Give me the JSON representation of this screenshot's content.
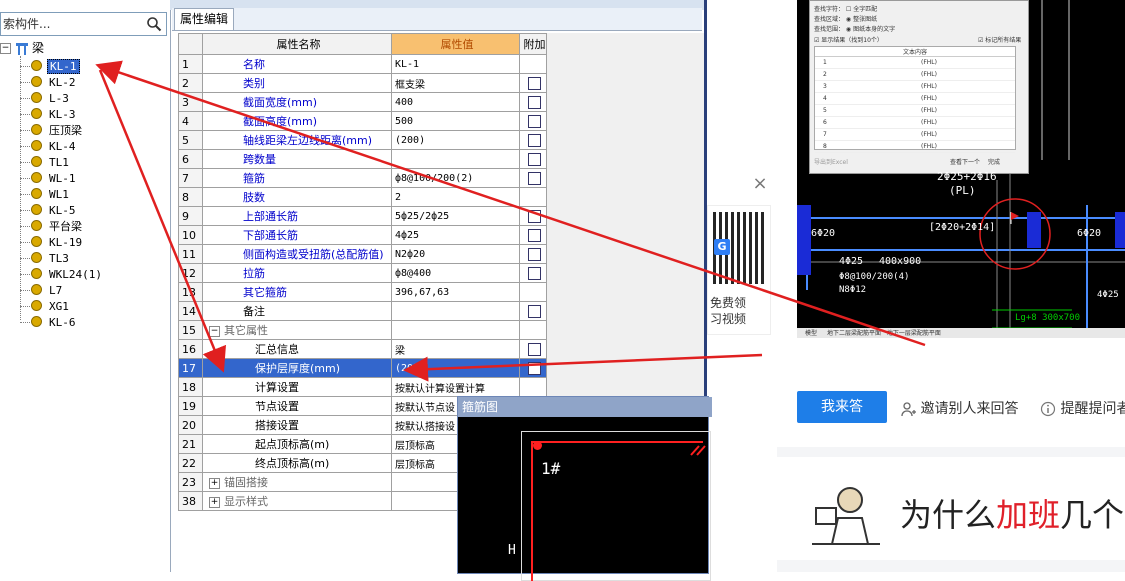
{
  "tree": {
    "search_placeholder": "索构件...",
    "root_label": "梁",
    "items": [
      "KL-1",
      "KL-2",
      "L-3",
      "KL-3",
      "压顶梁",
      "KL-4",
      "TL1",
      "WL-1",
      "WL1",
      "KL-5",
      "平台梁",
      "KL-19",
      "TL3",
      "WKL24(1)",
      "L7",
      "XG1",
      "KL-6"
    ],
    "selected_index": 0
  },
  "tabs": {
    "props": "属性编辑"
  },
  "grid": {
    "headers": {
      "name": "属性名称",
      "value": "属性值",
      "extra": "附加"
    },
    "rows": [
      {
        "num": "1",
        "name": "名称",
        "value": "KL-1",
        "check": false
      },
      {
        "num": "2",
        "name": "类别",
        "value": "框支梁",
        "check": true
      },
      {
        "num": "3",
        "name": "截面宽度(mm)",
        "value": "400",
        "check": true
      },
      {
        "num": "4",
        "name": "截面高度(mm)",
        "value": "500",
        "check": true
      },
      {
        "num": "5",
        "name": "轴线距梁左边线距离(mm)",
        "value": "(200)",
        "check": true
      },
      {
        "num": "6",
        "name": "跨数量",
        "value": "",
        "check": true
      },
      {
        "num": "7",
        "name": "箍筋",
        "value": "ф8@100/200(2)",
        "check": true
      },
      {
        "num": "8",
        "name": "肢数",
        "value": "2",
        "check": false
      },
      {
        "num": "9",
        "name": "上部通长筋",
        "value": "5ф25/2ф25",
        "check": true
      },
      {
        "num": "10",
        "name": "下部通长筋",
        "value": "4ф25",
        "check": true
      },
      {
        "num": "11",
        "name": "侧面构造或受扭筋(总配筋值)",
        "value": "N2ф20",
        "check": true
      },
      {
        "num": "12",
        "name": "拉筋",
        "value": "ф8@400",
        "check": true
      },
      {
        "num": "13",
        "name": "其它箍筋",
        "value": "396,67,63",
        "check": false
      },
      {
        "num": "14",
        "name": "备注",
        "value": "",
        "check": true
      },
      {
        "num": "15",
        "name": "其它属性",
        "value": "",
        "check": false
      },
      {
        "num": "16",
        "name": "汇总信息",
        "value": "梁",
        "check": true
      },
      {
        "num": "17",
        "name": "保护层厚度(mm)",
        "value": "(20)",
        "check": true
      },
      {
        "num": "18",
        "name": "计算设置",
        "value": "按默认计算设置计算",
        "check": false
      },
      {
        "num": "19",
        "name": "节点设置",
        "value": "按默认节点设",
        "check": false
      },
      {
        "num": "20",
        "name": "搭接设置",
        "value": "按默认搭接设",
        "check": false
      },
      {
        "num": "21",
        "name": "起点顶标高(m)",
        "value": "层顶标高",
        "check": false
      },
      {
        "num": "22",
        "name": "终点顶标高(m)",
        "value": "层顶标高",
        "check": false
      },
      {
        "num": "23",
        "name": "锚固搭接",
        "value": "",
        "check": false
      },
      {
        "num": "38",
        "name": "显示样式",
        "value": "",
        "check": false
      }
    ]
  },
  "popup": {
    "title": "箍筋图",
    "label_1": "1#",
    "label_h": "H"
  },
  "right": {
    "close": "×",
    "qr_line1": "免费领",
    "qr_line2": "习视频",
    "qr_badge": "G",
    "answer": "我来答",
    "invite": "邀请别人来回答",
    "remind": "提醒提问者",
    "headline_a": "为什么",
    "headline_b": "加班",
    "headline_c": "几个"
  },
  "cad": {
    "t1": "2Φ25+2Φ16",
    "t2": "(PL)",
    "t3": "[2Φ20+2Φ14]",
    "t4": "6Φ20",
    "t5": "6Φ20",
    "t6": "4Φ25",
    "t7": "400x900",
    "t8": "Φ8@100/200(4)",
    "t9": "N8Φ12",
    "t10": "Lg+8 300x700",
    "t11": "4Φ25",
    "dlg_row": "(FHL)",
    "dlg_head": "文本内容",
    "dlg_1": "查找字符：",
    "dlg_2": "全字匹配",
    "dlg_3": "查找区域：",
    "dlg_4": "整张图纸",
    "dlg_5": "查找范围：",
    "dlg_6": "图纸本身的文字",
    "dlg_7": "显示结果（找到10个）",
    "dlg_8": "标记所有结果",
    "dlg_btn1": "查看下一个",
    "dlg_btn2": "完成",
    "dlg_btn3": "导出到Excel",
    "tab1": "模型",
    "tab2": "地下二层梁配筋平面",
    "tab3": "地下一层梁配筋平面"
  },
  "colors": {
    "arrow": "#e02020",
    "selection": "#3366cc",
    "value_header": "#f8c070",
    "answer_button": "#1e7ee8"
  }
}
